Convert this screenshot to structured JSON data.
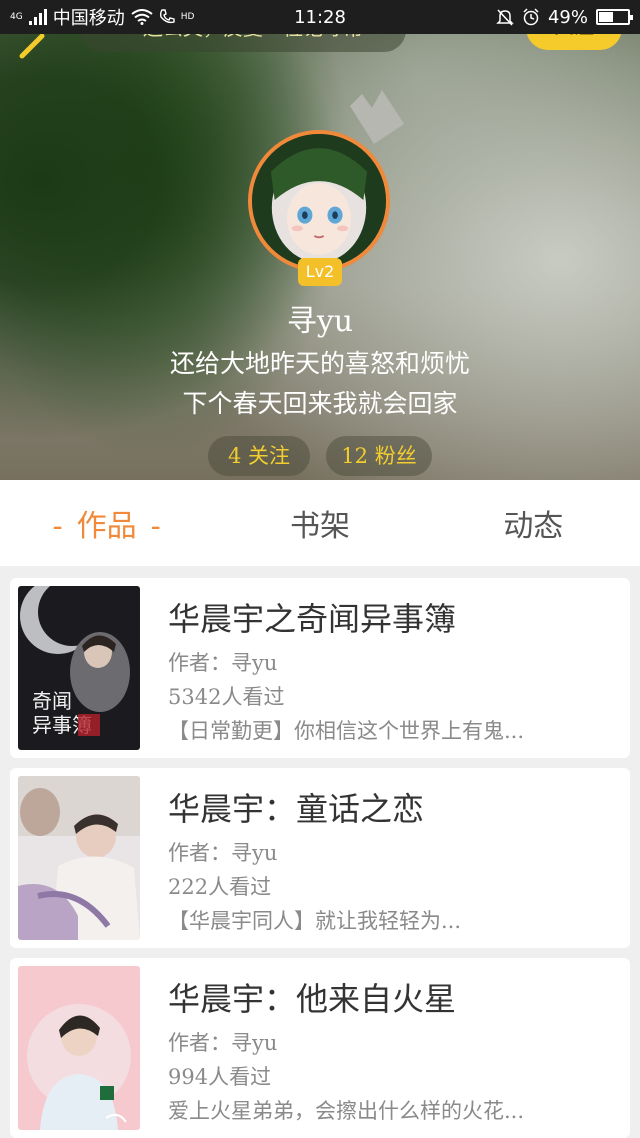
{
  "status_bar": {
    "network": "4G",
    "carrier": "中国移动",
    "hd": "HD",
    "time": "11:28",
    "battery": "49%",
    "battery_level": 0.49
  },
  "header": {
    "notice_text": "一遍公文，反复一位记寻常",
    "follow_button": "关注",
    "level": "Lv2",
    "user_name": "寻yu",
    "bio_line1": "还给大地昨天的喜怒和烦忧",
    "bio_line2": "下个春天回来我就会回家",
    "following": "4 关注",
    "fans": "12 粉丝"
  },
  "tabs": [
    {
      "label": "作品",
      "active": true,
      "dash": "-"
    },
    {
      "label": "书架",
      "active": false
    },
    {
      "label": "动态",
      "active": false
    }
  ],
  "works": [
    {
      "title": "华晨宇之奇闻异事簿",
      "author": "作者：寻yu",
      "views": "5342人看过",
      "desc": "【日常勤更】你相信这个世界上有鬼...",
      "cover_text": "奇闻异事簿"
    },
    {
      "title": "华晨宇：童话之恋",
      "author": "作者：寻yu",
      "views": "222人看过",
      "desc": "【华晨宇同人】就让我轻轻为..."
    },
    {
      "title": "华晨宇：他来自火星",
      "author": "作者：寻yu",
      "views": "994人看过",
      "desc": "爱上火星弟弟，会擦出什么样的火花..."
    }
  ],
  "colors": {
    "accent": "#f08a3a",
    "follow": "#f4cb2a",
    "stat_text": "#f2cd2e"
  }
}
